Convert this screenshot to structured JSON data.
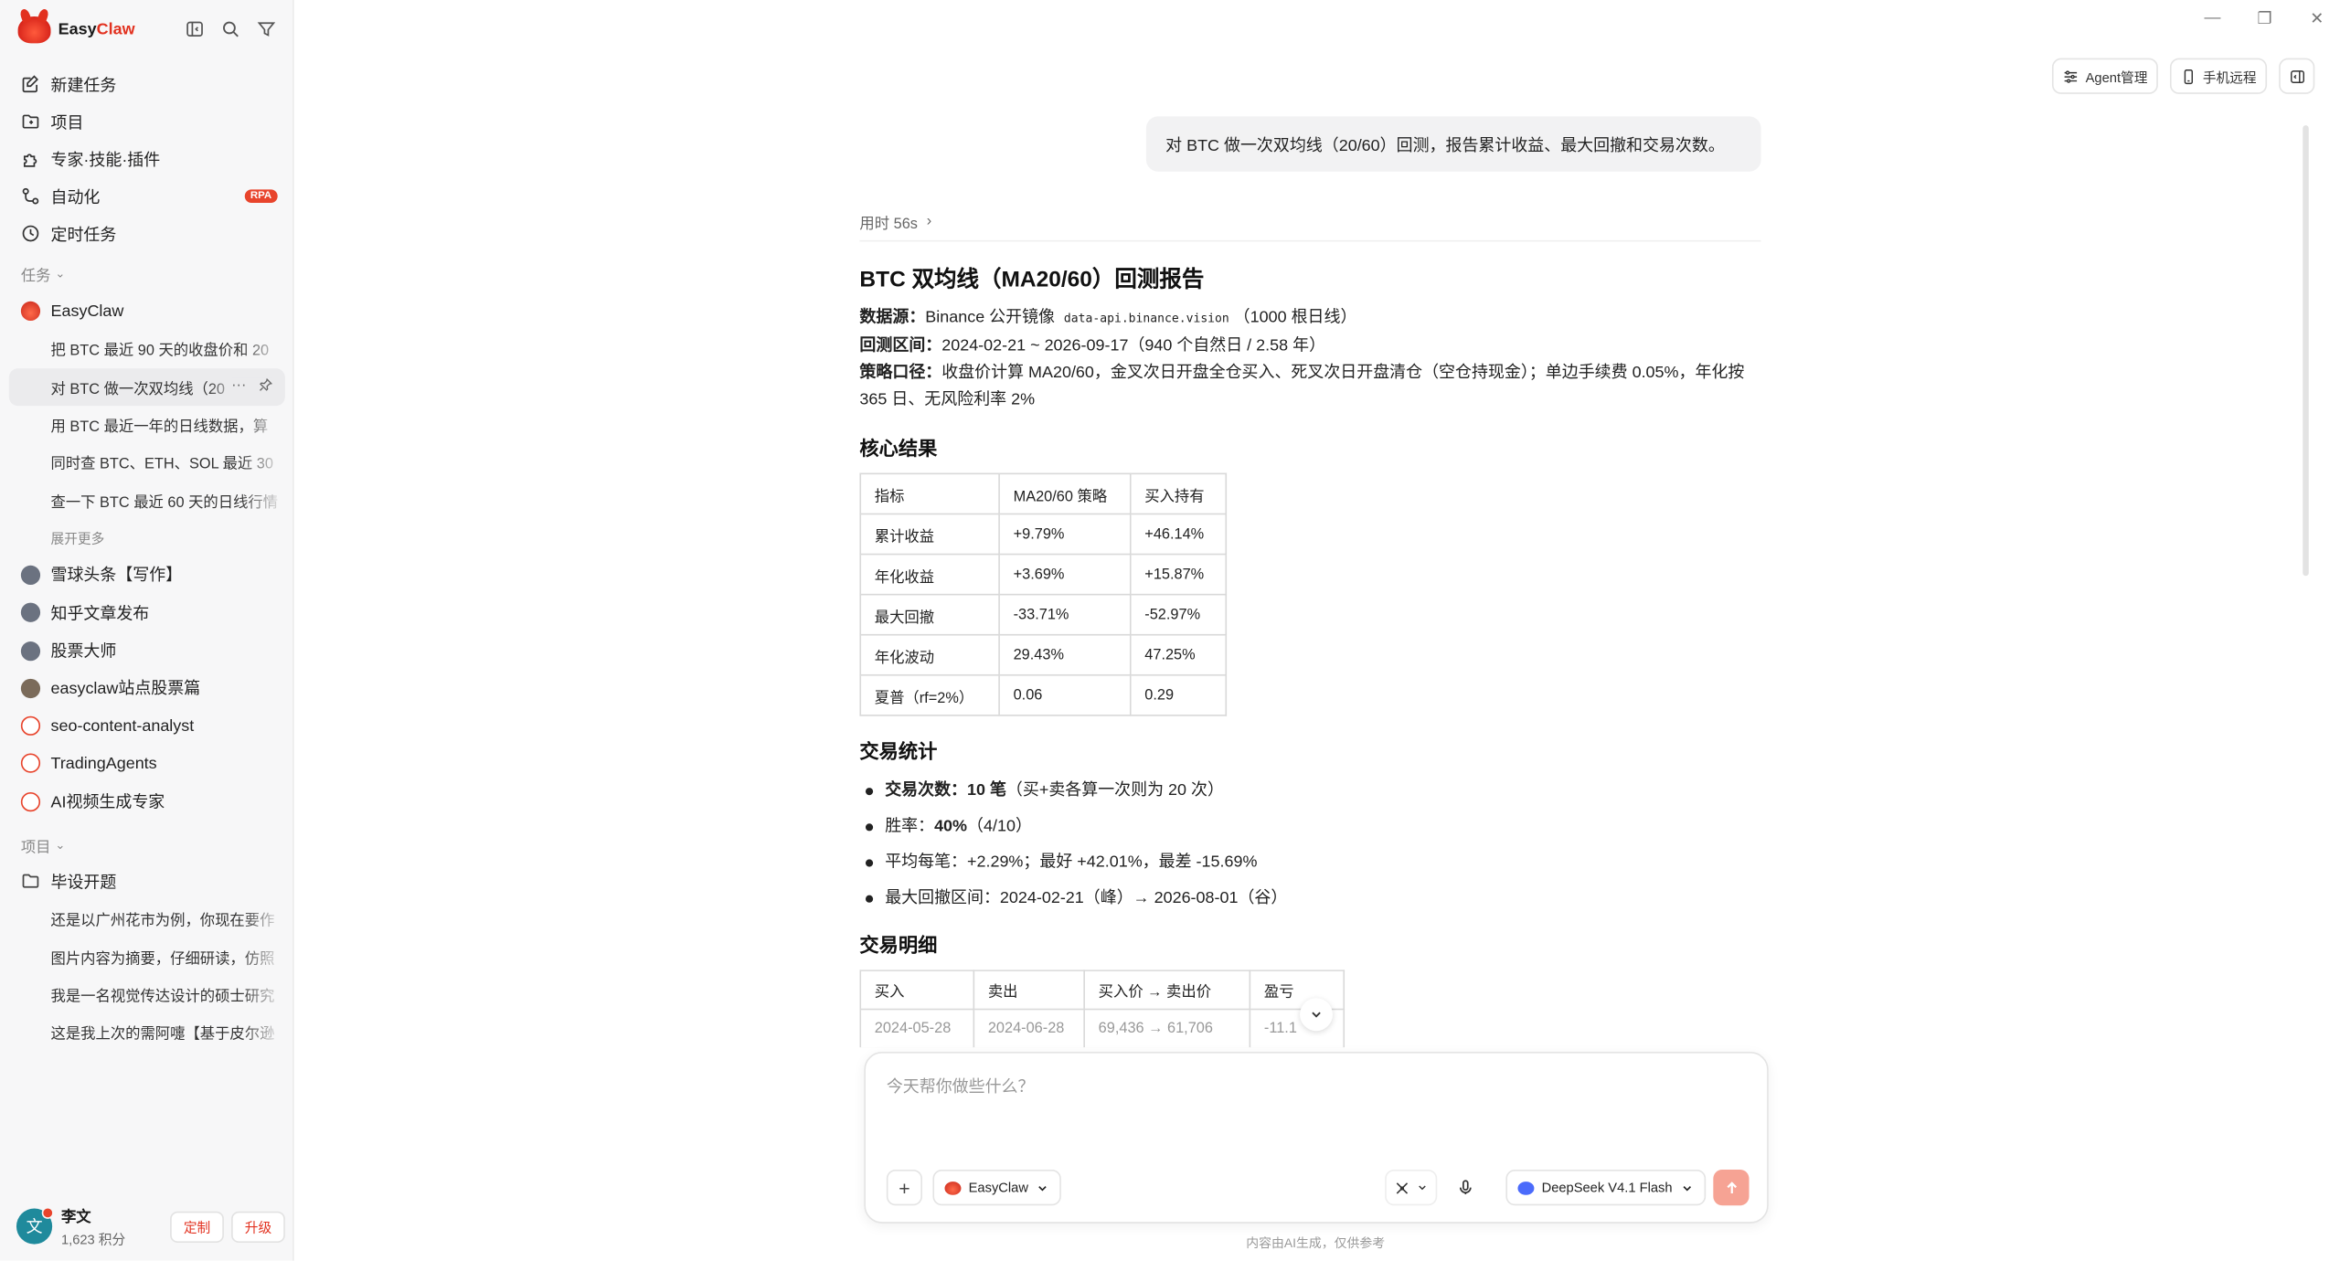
{
  "app": {
    "brand_name": "EasyClaw",
    "brand_part1": "Easy",
    "brand_part2": "Claw",
    "accent": "#e2311f"
  },
  "sidebar": {
    "nav": [
      {
        "label": "新建任务",
        "icon": "new-task-icon"
      },
      {
        "label": "项目",
        "icon": "folder-icon"
      },
      {
        "label": "专家·技能·插件",
        "icon": "puzzle-icon"
      },
      {
        "label": "自动化",
        "icon": "automation-icon",
        "badge": "RPA"
      },
      {
        "label": "定时任务",
        "icon": "clock-icon"
      }
    ],
    "tasks_section": "任务",
    "agents": [
      {
        "name": "EasyClaw",
        "avatar": "claw"
      },
      {
        "name": "雪球头条【写作】",
        "avatar": "person"
      },
      {
        "name": "知乎文章发布",
        "avatar": "person"
      },
      {
        "name": "股票大师",
        "avatar": "person"
      },
      {
        "name": "easyclaw站点股票篇",
        "avatar": "person2"
      },
      {
        "name": "seo-content-analyst",
        "avatar": "red"
      },
      {
        "name": "TradingAgents",
        "avatar": "red"
      },
      {
        "name": "AI视频生成专家",
        "avatar": "red"
      }
    ],
    "easyclaw_tasks": [
      "把 BTC 最近 90 天的收盘价和 20",
      "对 BTC 做一次双均线（20",
      "用 BTC 最近一年的日线数据，算",
      "同时查 BTC、ETH、SOL 最近 30",
      "查一下 BTC 最近 60 天的日线行情"
    ],
    "show_more": "展开更多",
    "projects_section": "项目",
    "project_folder": "毕设开题",
    "project_tasks": [
      "还是以广州花市为例，你现在要作",
      "图片内容为摘要，仔细研读，仿照",
      "我是一名视觉传达设计的硕士研究",
      "这是我上次的需阿嚏【基于皮尔逊"
    ],
    "user": {
      "initial": "文",
      "name": "李文",
      "points": "1,623 积分",
      "custom_btn": "定制",
      "upgrade_btn": "升级"
    }
  },
  "header": {
    "agent_manage": "Agent管理",
    "phone_remote": "手机远程"
  },
  "chat": {
    "user_message": "对 BTC 做一次双均线（20/60）回测，报告累计收益、最大回撤和交易次数。",
    "timing": "用时 56s",
    "report": {
      "title": "BTC 双均线（MA20/60）回测报告",
      "source_label": "数据源：",
      "source_text": "Binance 公开镜像",
      "source_code": "data-api.binance.vision",
      "source_tail": "（1000 根日线）",
      "range_label": "回测区间：",
      "range_text": "2024-02-21 ~ 2026-09-17（940 个自然日 / 2.58 年）",
      "strategy_label": "策略口径：",
      "strategy_text": "收盘价计算 MA20/60，金叉次日开盘全仓买入、死叉次日开盘清仓（空仓持现金）；单边手续费 0.05%，年化按 365 日、无风险利率 2%",
      "core_title": "核心结果",
      "core_headers": [
        "指标",
        "MA20/60 策略",
        "买入持有"
      ],
      "core_rows": [
        {
          "metric": "累计收益",
          "strategy": "+9.79%",
          "hold": "+46.14%",
          "bold": true
        },
        {
          "metric": "年化收益",
          "strategy": "+3.69%",
          "hold": "+15.87%",
          "bold": false
        },
        {
          "metric": "最大回撤",
          "strategy": "-33.71%",
          "hold": "-52.97%",
          "bold": true
        },
        {
          "metric": "年化波动",
          "strategy": "29.43%",
          "hold": "47.25%",
          "bold": false
        },
        {
          "metric": "夏普（rf=2%）",
          "strategy": "0.06",
          "hold": "0.29",
          "bold": false
        }
      ],
      "stats_title": "交易统计",
      "stats": [
        {
          "label": "交易次数：",
          "strong": "10 笔",
          "rest": "（买+卖各算一次则为 20 次）"
        },
        {
          "label": "胜率：",
          "strong": "40%",
          "rest": "（4/10）"
        },
        {
          "label": "平均每笔：",
          "strong": "",
          "rest": "+2.29%；最好 +42.01%，最差 -15.69%"
        },
        {
          "label": "最大回撤区间：",
          "strong": "",
          "rest": "2024-02-21（峰）→ 2026-08-01（谷）"
        }
      ],
      "detail_title": "交易明细",
      "detail_headers": [
        "买入",
        "卖出",
        "买入价 → 卖出价",
        "盈亏"
      ],
      "detail_rows": [
        {
          "buy": "2024-05-28",
          "sell": "2024-06-28",
          "prices": "69,436 → 61,706",
          "pnl": "-11.1"
        }
      ]
    }
  },
  "composer": {
    "placeholder": "今天帮你做些什么？",
    "agent": "EasyClaw",
    "model": "DeepSeek V4.1 Flash",
    "disclaimer": "内容由AI生成，仅供参考"
  }
}
